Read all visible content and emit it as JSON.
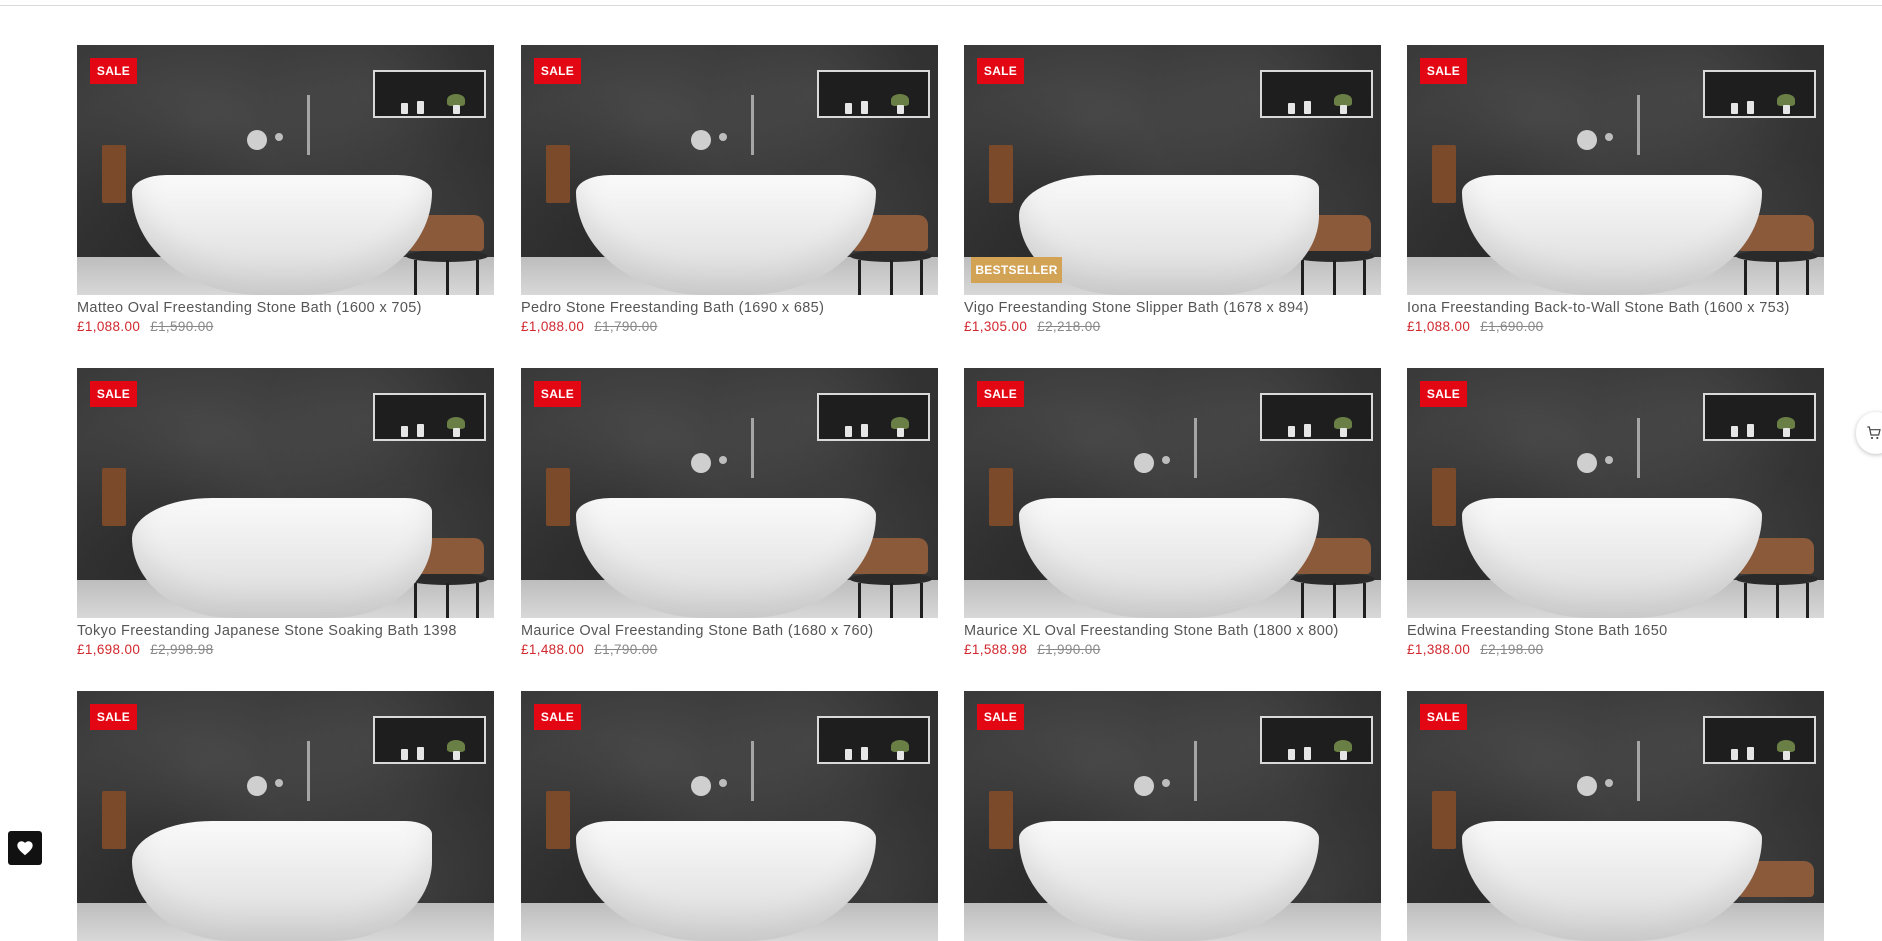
{
  "badges": {
    "sale": "SALE",
    "bestseller": "BESTSELLER"
  },
  "products": [
    {
      "title": "Matteo Oval Freestanding Stone Bath (1600 x 705)",
      "price": "£1,088.00",
      "compare_at": "£1,590.00",
      "badge": "SALE"
    },
    {
      "title": "Pedro Stone Freestanding Bath (1690 x 685)",
      "price": "£1,088.00",
      "compare_at": "£1,790.00",
      "badge": "SALE"
    },
    {
      "title": "Vigo Freestanding Stone Slipper Bath (1678 x 894)",
      "price": "£1,305.00",
      "compare_at": "£2,218.00",
      "badge": "SALE",
      "badge2": "BESTSELLER"
    },
    {
      "title": "Iona Freestanding Back-to-Wall Stone Bath (1600 x 753)",
      "price": "£1,088.00",
      "compare_at": "£1,690.00",
      "badge": "SALE"
    },
    {
      "title": "Tokyo Freestanding Japanese Stone Soaking Bath 1398",
      "price": "£1,698.00",
      "compare_at": "£2,998.98",
      "badge": "SALE"
    },
    {
      "title": "Maurice Oval Freestanding Stone Bath (1680 x 760)",
      "price": "£1,488.00",
      "compare_at": "£1,790.00",
      "badge": "SALE"
    },
    {
      "title": "Maurice XL Oval Freestanding Stone Bath (1800 x 800)",
      "price": "£1,588.98",
      "compare_at": "£1,990.00",
      "badge": "SALE"
    },
    {
      "title": "Edwina Freestanding Stone Bath 1650",
      "price": "£1,388.00",
      "compare_at": "£2,198.00",
      "badge": "SALE"
    },
    {
      "title": "",
      "price": "",
      "compare_at": "",
      "badge": "SALE"
    },
    {
      "title": "",
      "price": "",
      "compare_at": "",
      "badge": "SALE"
    },
    {
      "title": "",
      "price": "",
      "compare_at": "",
      "badge": "SALE"
    },
    {
      "title": "",
      "price": "",
      "compare_at": "",
      "badge": "SALE"
    }
  ],
  "icons": {
    "wishlist": "heart-icon",
    "cart": "cart-icon"
  },
  "colors": {
    "sale": "#e30613",
    "bestseller": "#d2a255",
    "price": "#d0282e",
    "compare": "#888888"
  }
}
